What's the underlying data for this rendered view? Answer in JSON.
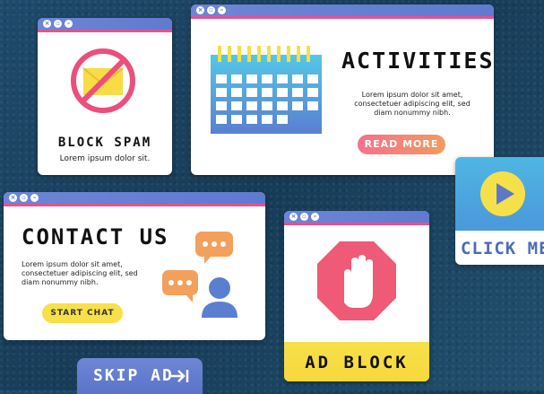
{
  "windows": {
    "block_spam": {
      "title": "BLOCK SPAM",
      "subtitle": "Lorem ipsum dolor sit."
    },
    "activities": {
      "title": "ACTIVITIES",
      "body": "Lorem ipsum dolor sit amet, consectetuer adipiscing elit, sed diam nonummy nibh.",
      "button": "READ MORE"
    },
    "contact": {
      "title": "CONTACT US",
      "body": "Lorem ipsum dolor sit amet, consectetuer adipiscing elit, sed diam nonummy nibh.",
      "button": "START CHAT"
    },
    "ad_block": {
      "title": "AD BLOCK"
    },
    "click_me": {
      "label": "CLICK ME"
    },
    "skip_ad": {
      "label": "SKIP AD"
    }
  },
  "colors": {
    "titlebar": "#6d85d6",
    "accent_pink": "#e6518d",
    "button_gradient_start": "#f6708b",
    "button_gradient_end": "#f29b5e",
    "yellow": "#f8e04a"
  },
  "icons": [
    "close-icon",
    "minimize-icon",
    "maximize-icon",
    "no-mail-icon",
    "calendar-icon",
    "chat-bubble-icon",
    "user-icon",
    "stop-hand-icon",
    "play-icon",
    "skip-arrow-icon"
  ]
}
